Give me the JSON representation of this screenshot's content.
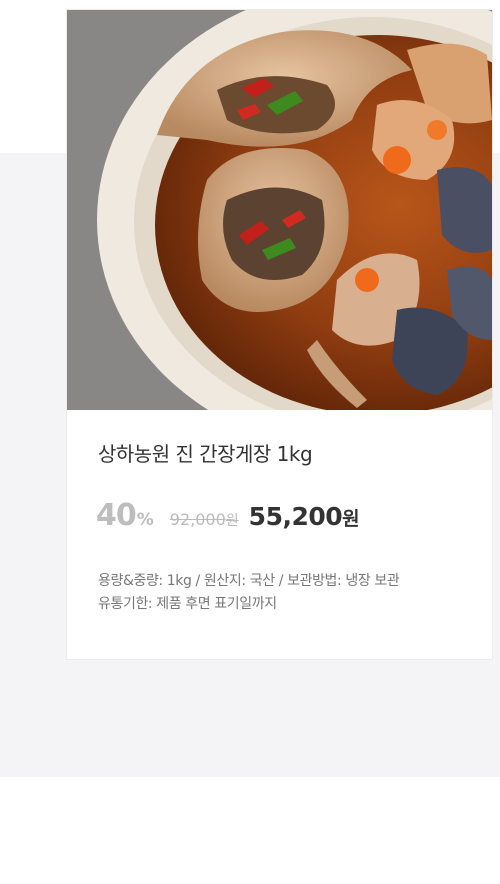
{
  "product": {
    "image_alt": "soy-sauce-marinated-crab-dish",
    "title": "상하농원 진 간장게장 1kg",
    "discount": "40",
    "discount_unit": "%",
    "original_price": "92,000",
    "original_unit": "원",
    "sale_price": "55,200",
    "sale_unit": "원",
    "info_line1": "용량&중량: 1kg / 원산지: 국산 / 보관방법: 냉장 보관",
    "info_line2": "유통기한: 제품 후면 표기일까지"
  },
  "colors": {
    "background_gray": "#f4f4f6",
    "card_border": "#ebebeb",
    "title_text": "#333333",
    "discount_text": "#bdbdbd",
    "info_text": "#777777"
  }
}
